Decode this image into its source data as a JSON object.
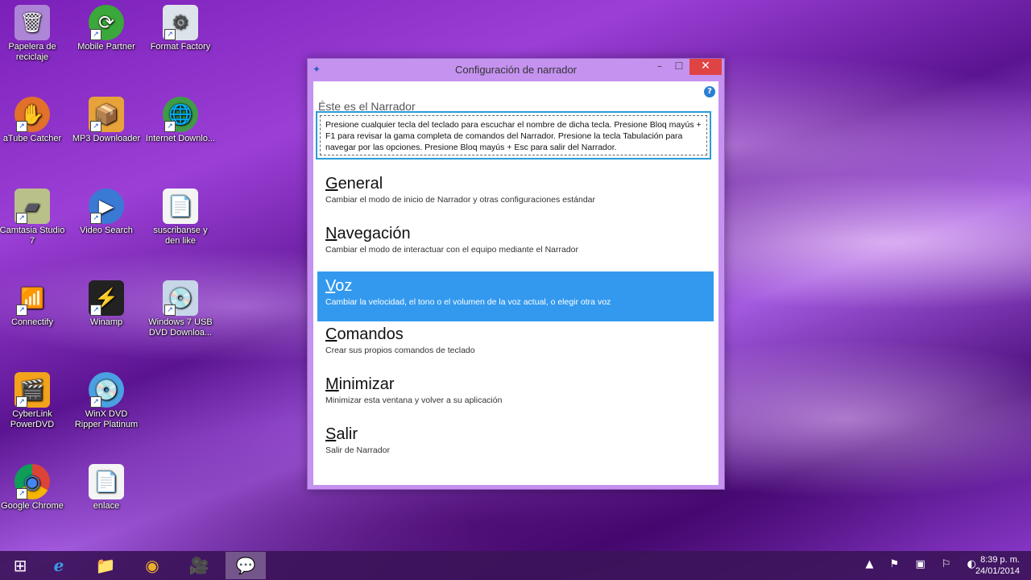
{
  "desktop": {
    "icons": [
      {
        "label": "Papelera de reciclaje",
        "glyph": "🗑"
      },
      {
        "label": "Mobile Partner",
        "glyph": "⟳"
      },
      {
        "label": "Format Factory",
        "glyph": "⚙"
      },
      {
        "label": "aTube Catcher",
        "glyph": "✋"
      },
      {
        "label": "MP3 Downloader",
        "glyph": "📦"
      },
      {
        "label": "Internet Downlo...",
        "glyph": "🌐"
      },
      {
        "label": "Camtasia Studio 7",
        "glyph": "▰"
      },
      {
        "label": "Video Search",
        "glyph": "▶"
      },
      {
        "label": "suscribanse y den like",
        "glyph": "📄"
      },
      {
        "label": "Connectify",
        "glyph": "📶"
      },
      {
        "label": "Winamp",
        "glyph": "⚡"
      },
      {
        "label": "Windows 7 USB DVD Downloa...",
        "glyph": "💿"
      },
      {
        "label": "CyberLink PowerDVD",
        "glyph": "🎬"
      },
      {
        "label": "WinX DVD Ripper Platinum",
        "glyph": "💿"
      },
      {
        "label": "Google Chrome",
        "glyph": "◉"
      },
      {
        "label": "enlace",
        "glyph": "📄"
      }
    ]
  },
  "window": {
    "title": "Configuración de narrador",
    "min_label": "–",
    "max_label": "☐",
    "close_label": "✕",
    "help_label": "?",
    "heading": "Éste es el Narrador",
    "info_text": "Presione cualquier tecla del teclado para escuchar el nombre de dicha tecla. Presione Bloq mayús + F1 para revisar la gama completa de comandos del Narrador. Presione la tecla Tabulación para navegar por las opciones. Presione Bloq mayús + Esc para salir del Narrador.",
    "items": [
      {
        "first": "G",
        "rest": "eneral",
        "desc": "Cambiar el modo de inicio de Narrador y otras configuraciones estándar"
      },
      {
        "first": "N",
        "rest": "avegación",
        "desc": "Cambiar el modo de interactuar con el equipo mediante el Narrador"
      },
      {
        "first": "V",
        "rest": "oz",
        "desc": "Cambiar la velocidad, el tono o el volumen de la voz actual, o elegir otra voz"
      },
      {
        "first": "C",
        "rest": "omandos",
        "desc": "Crear sus propios comandos de teclado"
      },
      {
        "first": "M",
        "rest": "inimizar",
        "desc": "Minimizar esta ventana y volver a su aplicación"
      },
      {
        "first": "S",
        "rest": "alir",
        "desc": "Salir de Narrador"
      }
    ],
    "selected_index": 2
  },
  "taskbar": {
    "time": "8:39 p. m.",
    "date": "24/01/2014",
    "tray_icons": "▲ ⚑ ▣ ⚐ ◐",
    "buttons": [
      "⊞",
      "ℯ",
      "📁",
      "◉",
      "🎥",
      "💬"
    ]
  },
  "colors": {
    "accent": "#3399ee",
    "close": "#e04343",
    "frame": "#c592f0"
  }
}
